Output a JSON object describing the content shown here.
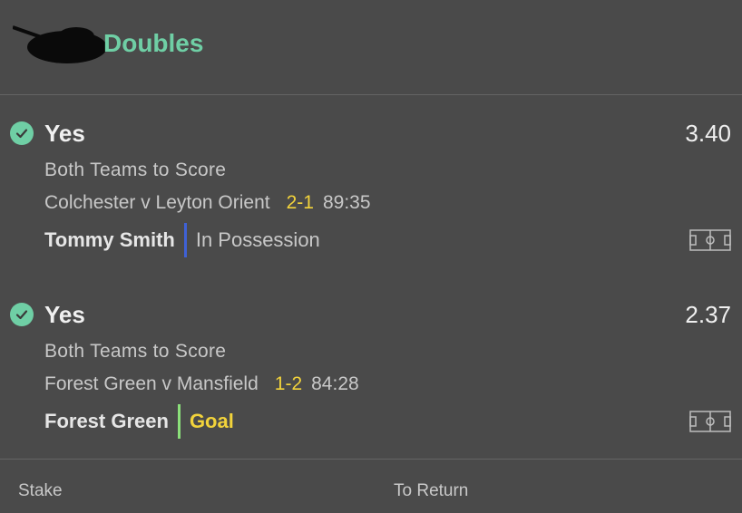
{
  "header": {
    "title": "Doubles"
  },
  "bets": [
    {
      "selection": "Yes",
      "odds": "3.40",
      "market": "Both Teams to Score",
      "match": "Colchester v Leyton Orient",
      "score": "2-1",
      "clock": "89:35",
      "team": "Tommy Smith",
      "status": "In Possession",
      "status_bar_color": "#3f61d6",
      "status_color": "#c8c8c8",
      "icons": [
        "check-icon",
        "pitch-icon"
      ]
    },
    {
      "selection": "Yes",
      "odds": "2.37",
      "market": "Both Teams to Score",
      "match": "Forest Green v Mansfield",
      "score": "1-2",
      "clock": "84:28",
      "team": "Forest Green",
      "status": "Goal",
      "status_bar_color": "#8be07a",
      "status_color": "#f2d33b",
      "icons": [
        "check-icon",
        "pitch-icon"
      ]
    }
  ],
  "footer": {
    "stake_label": "Stake",
    "return_label": "To Return"
  },
  "colors": {
    "background": "#4a4a4a",
    "accent": "#6fcfa5",
    "score": "#f2d33b"
  }
}
